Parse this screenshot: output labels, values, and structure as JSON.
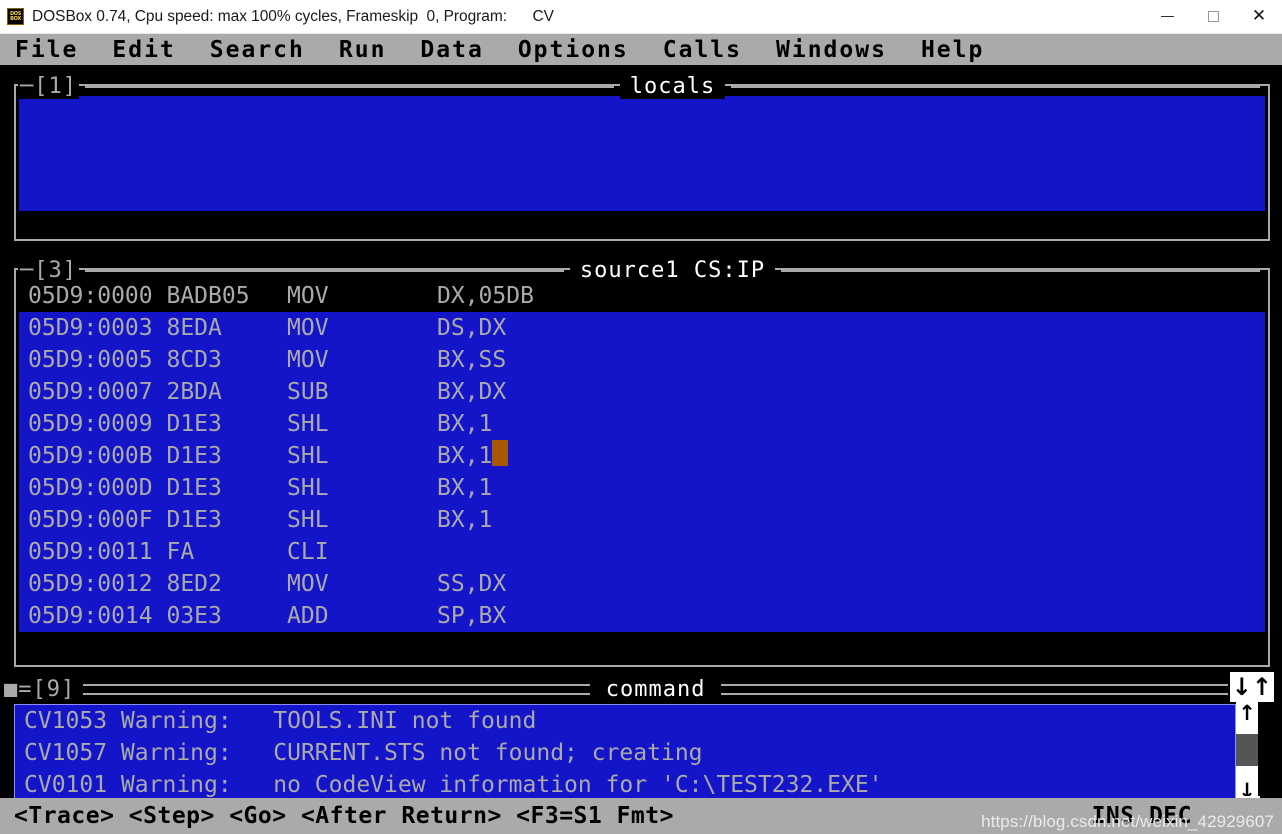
{
  "window": {
    "title": "DOSBox 0.74, Cpu speed: max 100% cycles, Frameskip  0, Program:      CV",
    "logo_top": "DOS",
    "logo_bottom": "BOX",
    "minimize_label": "—",
    "maximize_label": "□",
    "close_label": "✕"
  },
  "menubar": {
    "items": [
      {
        "label": "File"
      },
      {
        "label": "Edit"
      },
      {
        "label": "Search"
      },
      {
        "label": "Run"
      },
      {
        "label": "Data"
      },
      {
        "label": "Options"
      },
      {
        "label": "Calls"
      },
      {
        "label": "Windows"
      },
      {
        "label": "Help"
      }
    ]
  },
  "locals_window": {
    "number": "─[1]",
    "title": "locals",
    "content": ""
  },
  "source_window": {
    "number": "─[3]",
    "title": "source1 CS:IP",
    "lines": [
      {
        "address": "05D9:0000",
        "bytes": "BADB05",
        "mnemonic": "MOV",
        "operands": "DX,05DB",
        "highlight": false,
        "cursor": false
      },
      {
        "address": "05D9:0003",
        "bytes": "8EDA",
        "mnemonic": "MOV",
        "operands": "DS,DX",
        "highlight": true,
        "cursor": false
      },
      {
        "address": "05D9:0005",
        "bytes": "8CD3",
        "mnemonic": "MOV",
        "operands": "BX,SS",
        "highlight": true,
        "cursor": false
      },
      {
        "address": "05D9:0007",
        "bytes": "2BDA",
        "mnemonic": "SUB",
        "operands": "BX,DX",
        "highlight": true,
        "cursor": false
      },
      {
        "address": "05D9:0009",
        "bytes": "D1E3",
        "mnemonic": "SHL",
        "operands": "BX,1",
        "highlight": true,
        "cursor": false
      },
      {
        "address": "05D9:000B",
        "bytes": "D1E3",
        "mnemonic": "SHL",
        "operands": "BX,1",
        "highlight": true,
        "cursor": true
      },
      {
        "address": "05D9:000D",
        "bytes": "D1E3",
        "mnemonic": "SHL",
        "operands": "BX,1",
        "highlight": true,
        "cursor": false
      },
      {
        "address": "05D9:000F",
        "bytes": "D1E3",
        "mnemonic": "SHL",
        "operands": "BX,1",
        "highlight": true,
        "cursor": false
      },
      {
        "address": "05D9:0011",
        "bytes": "FA",
        "mnemonic": "CLI",
        "operands": "",
        "highlight": true,
        "cursor": false
      },
      {
        "address": "05D9:0012",
        "bytes": "8ED2",
        "mnemonic": "MOV",
        "operands": "SS,DX",
        "highlight": true,
        "cursor": false
      },
      {
        "address": "05D9:0014",
        "bytes": "03E3",
        "mnemonic": "ADD",
        "operands": "SP,BX",
        "highlight": true,
        "cursor": false
      }
    ]
  },
  "command_window": {
    "marker": "■=[9]",
    "title": "command",
    "size_icons": "↓↑",
    "lines": [
      "CV1053 Warning:   TOOLS.INI not found",
      "CV1057 Warning:   CURRENT.STS not found; creating",
      "CV0101 Warning:   no CodeView information for 'C:\\TEST232.EXE'"
    ],
    "vscroll": {
      "up_arrow": "↑",
      "down_arrow": "↓",
      "resize_corner": "⮡"
    },
    "hscroll": {
      "left_arrow": "←",
      "right_arrow": "→"
    }
  },
  "statusbar": {
    "keys": "<Trace> <Step> <Go> <After Return> <F3=S1 Fmt>",
    "indicators": "INS DEC",
    "watermark": "https://blog.csdn.net/weixin_42929607"
  },
  "colors": {
    "dos_blue": "#1414c8",
    "dos_gray": "#aaaaaa",
    "dos_black": "#000000",
    "cursor_brown": "#a85800",
    "scroll_thumb": "#555555"
  }
}
